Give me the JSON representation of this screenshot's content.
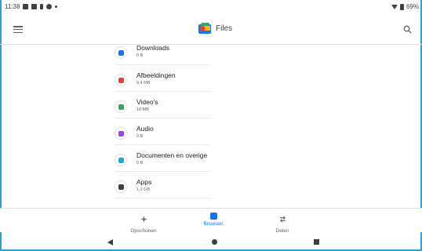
{
  "status": {
    "time": "11:38",
    "battery": "69%"
  },
  "appbar": {
    "title": "Files"
  },
  "categories": [
    {
      "label": "Downloads",
      "size": "0 B",
      "color": "#1a73e8",
      "icon": "download-icon"
    },
    {
      "label": "Afbeeldingen",
      "size": "9,4 MB",
      "color": "#ea4335",
      "icon": "image-icon"
    },
    {
      "label": "Video's",
      "size": "18 MB",
      "color": "#34a853",
      "icon": "video-icon"
    },
    {
      "label": "Audio",
      "size": "0 B",
      "color": "#a142f4",
      "icon": "music-icon"
    },
    {
      "label": "Documenten en overige",
      "size": "0 B",
      "color": "#12b5cb",
      "icon": "document-icon"
    },
    {
      "label": "Apps",
      "size": "1,2 GB",
      "color": "#3c4043",
      "icon": "apps-icon"
    }
  ],
  "bottom_nav": {
    "clean": "Opschonen",
    "browse": "Browsen",
    "share": "Delen",
    "active_color": "#1a73e8"
  }
}
